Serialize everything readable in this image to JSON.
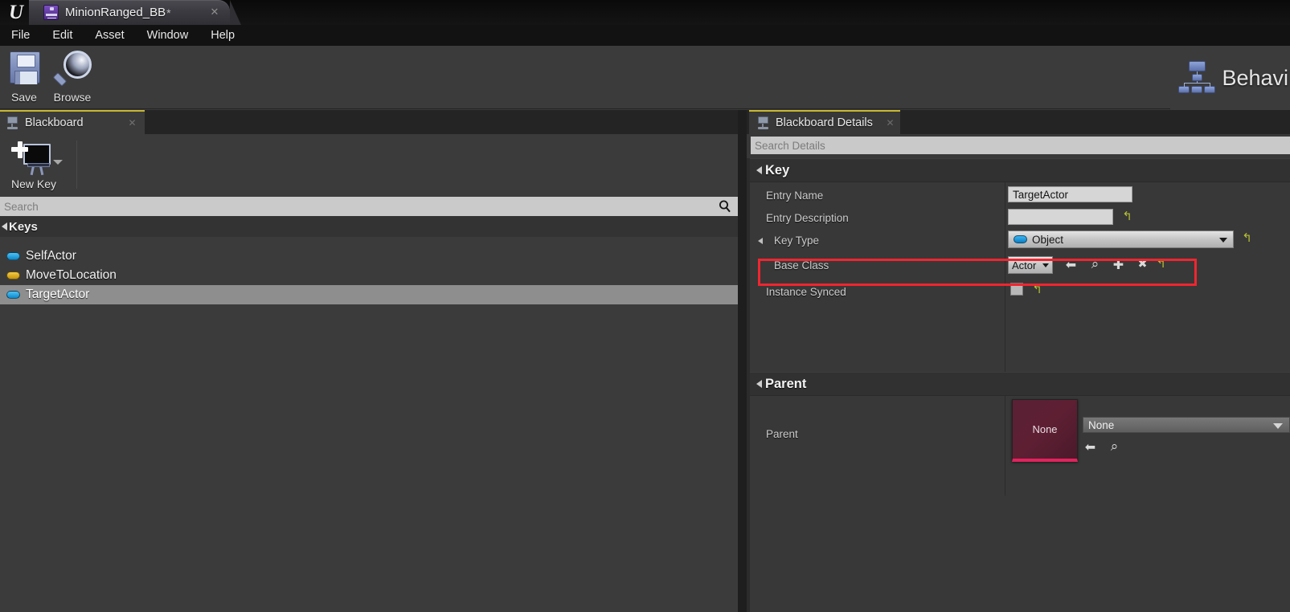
{
  "titlebar": {
    "logo": "unreal-logo",
    "asset_tab_label": "MinionRanged_BB",
    "asset_tab_dirty_marker": "*",
    "close_glyph": "✕"
  },
  "menubar": {
    "items": [
      {
        "label": "File"
      },
      {
        "label": "Edit"
      },
      {
        "label": "Asset"
      },
      {
        "label": "Window"
      },
      {
        "label": "Help"
      }
    ]
  },
  "toolbar": {
    "buttons": [
      {
        "label": "Save",
        "icon": "floppy-disk-icon"
      },
      {
        "label": "Browse",
        "icon": "magnifier-icon"
      }
    ],
    "mode_button": {
      "label": "Behavi",
      "icon": "behavior-tree-icon"
    }
  },
  "blackboard_panel": {
    "tab_label": "Blackboard",
    "tab_icon": "blackboard-icon",
    "close_glyph": "✕",
    "new_key_button": {
      "label": "New Key",
      "icon": "new-key-icon"
    },
    "search": {
      "value": "",
      "placeholder": "Search",
      "icon": "search-icon"
    },
    "keys_section_label": "Keys",
    "keys": [
      {
        "name": "SelfActor",
        "type_color": "#22a7e8",
        "selected": false
      },
      {
        "name": "MoveToLocation",
        "type_color": "#e8b820",
        "selected": false
      },
      {
        "name": "TargetActor",
        "type_color": "#22a7e8",
        "selected": true
      }
    ]
  },
  "details_panel": {
    "tab_label": "Blackboard Details",
    "tab_icon": "blackboard-icon",
    "close_glyph": "✕",
    "search": {
      "value": "",
      "placeholder": "Search Details"
    },
    "key_category": {
      "label": "Key",
      "entry_name": {
        "label": "Entry Name",
        "value": "TargetActor"
      },
      "entry_description": {
        "label": "Entry Description",
        "value": "",
        "reset_glyph": "↰"
      },
      "key_type": {
        "label": "Key Type",
        "value": "Object",
        "chip_color": "#22a7e8",
        "reset_glyph": "↰"
      },
      "base_class": {
        "label": "Base Class",
        "value": "Actor",
        "highlighted": true,
        "highlight_color": "#ef2630",
        "actions": [
          {
            "name": "browse-back-icon",
            "glyph": "⬅"
          },
          {
            "name": "browse-asset-icon",
            "glyph": "⌕"
          },
          {
            "name": "use-selected-icon",
            "glyph": "✚"
          },
          {
            "name": "clear-icon",
            "glyph": "✖"
          },
          {
            "name": "reset-icon",
            "glyph": "↰"
          }
        ]
      },
      "instance_synced": {
        "label": "Instance Synced",
        "checked": false,
        "reset_glyph": "↰"
      }
    },
    "parent_category": {
      "label": "Parent",
      "parent": {
        "label": "Parent",
        "thumbnail_text": "None",
        "combo_value": "None",
        "actions": [
          {
            "name": "browse-back-icon",
            "glyph": "⬅"
          },
          {
            "name": "browse-asset-icon",
            "glyph": "⌕"
          }
        ]
      }
    }
  },
  "colors": {
    "accent_tab_underline": "#c8b830",
    "highlight_red": "#ef2630",
    "object_key_blue": "#22a7e8",
    "vector_key_yellow": "#e8b820",
    "reset_arrow_olive": "#b5c034",
    "thumbnail_maroon": "#5e1f33",
    "thumbnail_stripe": "#e0245e"
  }
}
